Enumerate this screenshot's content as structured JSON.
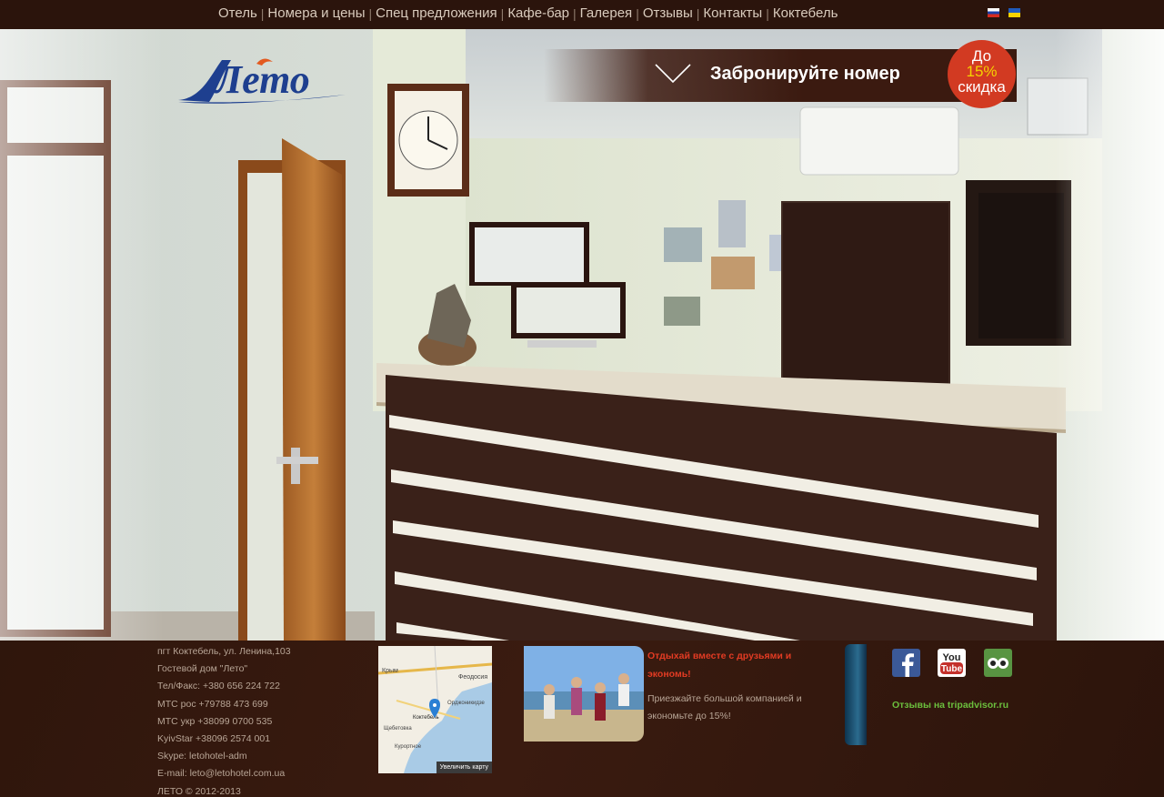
{
  "nav": {
    "items": [
      {
        "label": "Отель"
      },
      {
        "label": "Номера и цены"
      },
      {
        "label": "Спец предложения"
      },
      {
        "label": "Кафе-бар"
      },
      {
        "label": "Галерея"
      },
      {
        "label": "Отзывы"
      },
      {
        "label": "Контакты"
      },
      {
        "label": "Коктебель"
      }
    ],
    "separator": "|",
    "languages": [
      "ru-flag",
      "ua-flag"
    ]
  },
  "logo": {
    "text": "Лето"
  },
  "booking": {
    "label": "Забронируйте номер",
    "badge_top": "До",
    "badge_pct": "15%",
    "badge_bottom": "скидка"
  },
  "footer": {
    "contacts": [
      "пгт Коктебель, ул. Ленина,103",
      "Гостевой дом \"Лето\"",
      "Тел/Факс: +380 656 224 722",
      "МТС рос +79788 473 699",
      "МТС укр +38099 0700 535",
      "KyivStar +38096 2574 001",
      "Skype: letohotel-adm",
      "E-mail: leto@letohotel.com.ua",
      "ЛЕТО © 2012-2013"
    ],
    "map": {
      "labels": [
        "Крым",
        "Феодосия",
        "Коктебель",
        "Орджоникидзе",
        "Щебетовка",
        "Курортное"
      ],
      "button": "Увеличить карту"
    },
    "promo": {
      "title": "Отдыхай вместе с друзьями и экономь!",
      "text": "Приезжайте большой компанией и экономьте до 15%!"
    },
    "social": [
      "facebook-icon",
      "youtube-icon",
      "tripadvisor-icon"
    ],
    "youtube_text": "You Tube",
    "tripadvisor_link": "Отзывы на tripadvisor.ru"
  },
  "colors": {
    "brand_brown": "#2b140c",
    "accent_red": "#d23a22",
    "accent_yellow": "#f4d200",
    "link_green": "#6bbf3d"
  }
}
